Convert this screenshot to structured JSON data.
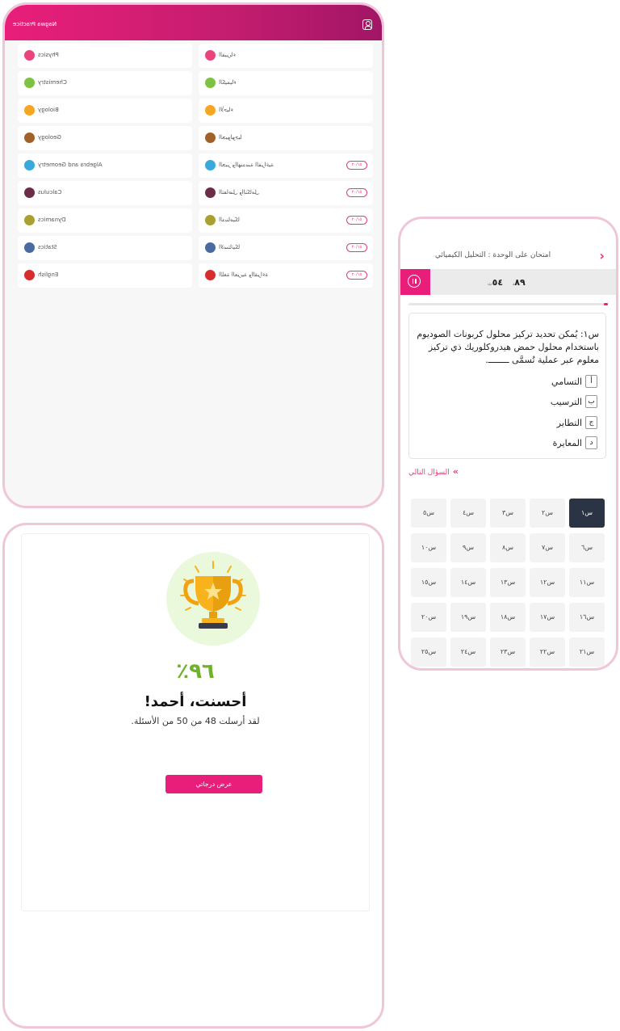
{
  "subjects_screen": {
    "app_title": "Nagwa Practice",
    "rows": [
      {
        "en": "Physics",
        "ar": "الفيزياء",
        "color": "#e8457a",
        "badge": ""
      },
      {
        "en": "Chemistry",
        "ar": "الكيمياء",
        "color": "#7dc242",
        "badge": ""
      },
      {
        "en": "Biology",
        "ar": "الأحياء",
        "color": "#f5a623",
        "badge": ""
      },
      {
        "en": "Geology",
        "ar": "الجيولوجيا",
        "color": "#a0622a",
        "badge": ""
      },
      {
        "en": "Algebra and Geometry",
        "ar": "الجبر والهندسة الفراغية",
        "color": "#3aa8d8",
        "badge": "٢٠/١٥"
      },
      {
        "en": "Calculus",
        "ar": "التفاضل والتكامل",
        "color": "#6a2c46",
        "badge": "٢٠/١٥"
      },
      {
        "en": "Dynamics",
        "ar": "الديناميكا",
        "color": "#a8a030",
        "badge": "٢٠/١٥"
      },
      {
        "en": "Statics",
        "ar": "الاستاتيكا",
        "color": "#4a6aa0",
        "badge": "٢٠/١٥"
      },
      {
        "en": "English",
        "ar": "اللغة العربية والقراءة",
        "color": "#d62d2d",
        "badge": "٢٠/١٥"
      }
    ]
  },
  "exam_screen": {
    "title": "امتحان على الوحدة : التحليل الكيميائي",
    "timer": {
      "minutes": "٨٩",
      "min_unit": "د",
      "seconds": "٥٤",
      "sec_unit": "ث"
    },
    "progress_fraction": 0.02,
    "question": "س١: يُمكن تحديد تركيز محلول كربونات الصوديوم باستخدام محلول حمض هيدروكلوريك ذي تركيز معلوم عبر عملية تُسمَّى ــــــــ.",
    "options": [
      {
        "key": "أ",
        "text": "التسامي"
      },
      {
        "key": "ب",
        "text": "الترسيب"
      },
      {
        "key": "ج",
        "text": "التطاير"
      },
      {
        "key": "د",
        "text": "المعايرة"
      }
    ],
    "next_label": "السؤال التالي",
    "question_numbers": [
      "س١",
      "س٢",
      "س٣",
      "س٤",
      "س٥",
      "س٦",
      "س٧",
      "س٨",
      "س٩",
      "س١٠",
      "س١١",
      "س١٢",
      "س١٣",
      "س١٤",
      "س١٥",
      "س١٦",
      "س١٧",
      "س١٨",
      "س١٩",
      "س٢٠",
      "س٢١",
      "س٢٢",
      "س٢٣",
      "س٢٤",
      "س٢٥"
    ],
    "active_question": 0
  },
  "result_screen": {
    "score": "٩٦٪",
    "praise": "أحسنت، أحمد!",
    "summary": "لقد أرسلت 48 من 50 من الأسئلة.",
    "view_button": "عرض درجاتي"
  }
}
